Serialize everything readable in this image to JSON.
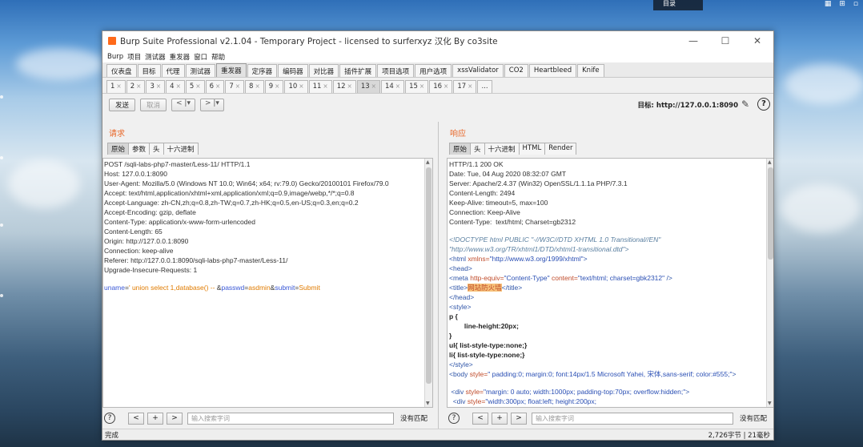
{
  "desktop": {
    "tab_label": "目录",
    "icons": [
      "▦",
      "⊞",
      "▫"
    ]
  },
  "window": {
    "title": "Burp Suite Professional v2.1.04 - Temporary Project - licensed to surferxyz 汉化 By co3site",
    "controls": {
      "minimize": "—",
      "maximize": "☐",
      "close": "✕"
    }
  },
  "menubar": [
    "Burp",
    "项目",
    "测试器",
    "重发器",
    "窗口",
    "帮助"
  ],
  "main_tabs": [
    {
      "label": "仪表盘"
    },
    {
      "label": "目标"
    },
    {
      "label": "代理"
    },
    {
      "label": "测试器"
    },
    {
      "label": "重发器",
      "active": true
    },
    {
      "label": "定序器"
    },
    {
      "label": "编码器"
    },
    {
      "label": "对比器"
    },
    {
      "label": "插件扩展"
    },
    {
      "label": "项目选项"
    },
    {
      "label": "用户选项"
    },
    {
      "label": "xssValidator"
    },
    {
      "label": "CO2"
    },
    {
      "label": "Heartbleed"
    },
    {
      "label": "Knife"
    }
  ],
  "repeater_tabs": [
    {
      "label": "1",
      "close": "×"
    },
    {
      "label": "2",
      "close": "×"
    },
    {
      "label": "3",
      "close": "×"
    },
    {
      "label": "4",
      "close": "×"
    },
    {
      "label": "5",
      "close": "×"
    },
    {
      "label": "6",
      "close": "×"
    },
    {
      "label": "7",
      "close": "×"
    },
    {
      "label": "8",
      "close": "×"
    },
    {
      "label": "9",
      "close": "×"
    },
    {
      "label": "10",
      "close": "×"
    },
    {
      "label": "11",
      "close": "×"
    },
    {
      "label": "12",
      "close": "×"
    },
    {
      "label": "13",
      "close": "×",
      "active": true
    },
    {
      "label": "14",
      "close": "×"
    },
    {
      "label": "15",
      "close": "×"
    },
    {
      "label": "16",
      "close": "×"
    },
    {
      "label": "17",
      "close": "×"
    },
    {
      "label": "...",
      "close": ""
    }
  ],
  "toolbar": {
    "send_label": "发送",
    "cancel_label": "取消",
    "back_label": "< |▾",
    "forward_label": "> |▾",
    "target_label": "目标: http://127.0.0.1:8090"
  },
  "request": {
    "title": "请求",
    "tabs": [
      {
        "label": "原始",
        "active": true
      },
      {
        "label": "参数"
      },
      {
        "label": "头"
      },
      {
        "label": "十六进制"
      }
    ],
    "lines": [
      "POST /sqli-labs-php7-master/Less-11/ HTTP/1.1",
      "Host: 127.0.0.1:8090",
      "User-Agent: Mozilla/5.0 (Windows NT 10.0; Win64; x64; rv:79.0) Gecko/20100101 Firefox/79.0",
      "Accept: text/html,application/xhtml+xml,application/xml;q=0.9,image/webp,*/*;q=0.8",
      "Accept-Language: zh-CN,zh;q=0.8,zh-TW;q=0.7,zh-HK;q=0.5,en-US;q=0.3,en;q=0.2",
      "Accept-Encoding: gzip, deflate",
      "Content-Type: application/x-www-form-urlencoded",
      "Content-Length: 65",
      "Origin: http://127.0.0.1:8090",
      "Connection: keep-alive",
      "Referer: http://127.0.0.1:8090/sqli-labs-php7-master/Less-11/",
      "Upgrade-Insecure-Requests: 1"
    ],
    "body": {
      "p1_name": "uname",
      "eq": "=",
      "p1_value": "' union select 1,database() -- ",
      "amp": "&",
      "p2_name": "passwd",
      "p2_value": "asdmin",
      "p3_name": "submit",
      "p3_value": "Submit"
    },
    "search_placeholder": "输入搜索字词",
    "no_match": "没有匹配"
  },
  "response": {
    "title": "响应",
    "tabs": [
      {
        "label": "原始",
        "active": true
      },
      {
        "label": "头"
      },
      {
        "label": "十六进制"
      },
      {
        "label": "HTML"
      },
      {
        "label": "Render"
      }
    ],
    "header_lines": [
      "HTTP/1.1 200 OK",
      "Date: Tue, 04 Aug 2020 08:32:07 GMT",
      "Server: Apache/2.4.37 (Win32) OpenSSL/1.1.1a PHP/7.3.1",
      "Content-Length: 2494",
      "Keep-Alive: timeout=5, max=100",
      "Connection: Keep-Alive",
      "Content-Type:  text/html; Charset=gb2312"
    ],
    "html": {
      "doctype1": "<!DOCTYPE html PUBLIC \"-//W3C//DTD XHTML 1.0 Transitional//EN\"",
      "doctype2": "\"http://www.w3.org/TR/xhtml1/DTD/xhtml1-transitional.dtd\">",
      "html_open": "<html ",
      "html_attr": "xmlns=",
      "html_val": "\"http://www.w3.org/1999/xhtml\"",
      "gt": ">",
      "head_open": "<head>",
      "meta_open": "<meta ",
      "meta_attr1": "http-equiv=",
      "meta_val1": "\"Content-Type\"",
      "meta_attr2": " content=",
      "meta_val2": "\"text/html; charset=gbk2312\"",
      "meta_close": " />",
      "title_open": "<title>",
      "title_text": "网站防火墙",
      "title_close": "</title>",
      "head_close": "</head>",
      "style_open": "<style>",
      "css1": "p {",
      "css2": "        line-height:20px;",
      "css3": "}",
      "css4": "ul{ list-style-type:none;}",
      "css5": "li{ list-style-type:none;}",
      "style_close": "</style>",
      "body_open": "<body ",
      "body_attr": "style=",
      "body_val": "\" padding:0; margin:0; font:14px/1.5 Microsoft Yahei, 宋体,sans-serif; color:#555;\"",
      "div1_open": " <div ",
      "div1_attr": "style=",
      "div1_val": "\"margin: 0 auto; width:1000px; padding-top:70px; overflow:hidden;\"",
      "div2_open": "  <div ",
      "div2_attr": "style=",
      "div2_val": "\"width:300px; float:left; height:200px;"
    },
    "search_placeholder": "输入搜索字词",
    "no_match": "没有匹配"
  },
  "status": {
    "left": "完成",
    "right": "2,726字节 | 21毫秒"
  },
  "search_buttons": {
    "prev": "<",
    "add": "+",
    "next": ">",
    "help": "?"
  }
}
